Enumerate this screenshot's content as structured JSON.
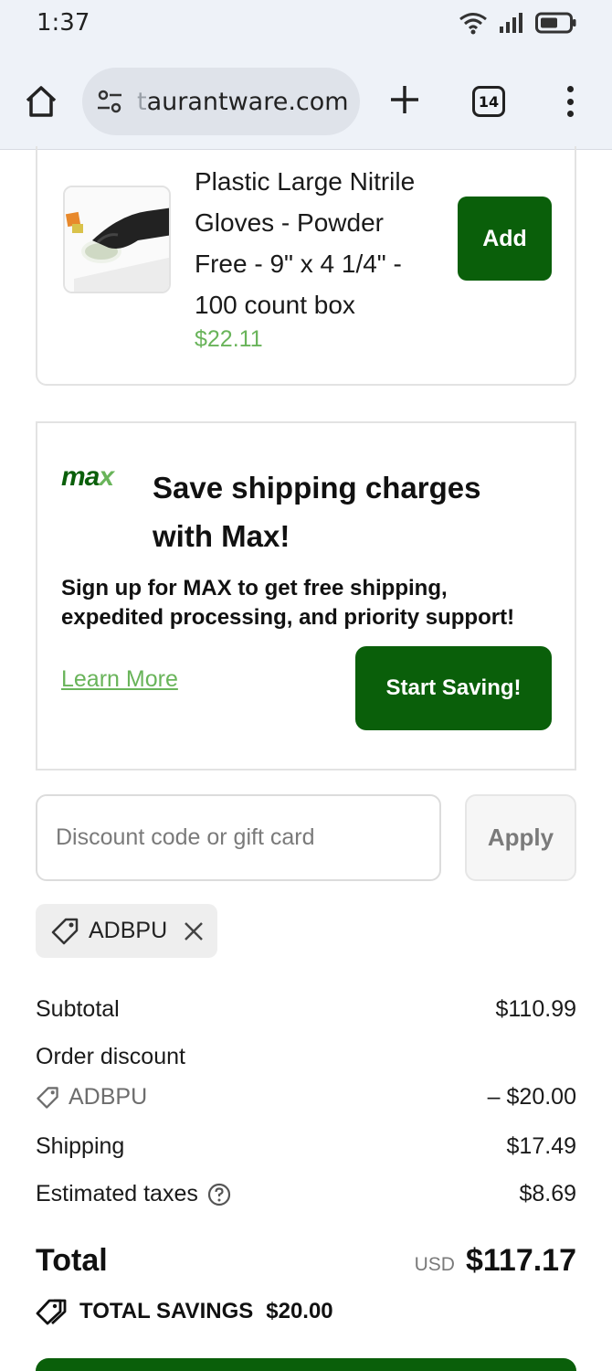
{
  "status_bar": {
    "time": "1:37"
  },
  "browser": {
    "url_dim": "t",
    "url_main": "aurantware.com",
    "tab_count": "14"
  },
  "product": {
    "name": "Plastic Large Nitrile Gloves - Powder Free - 9\" x 4 1/4\" - 100 count box",
    "price": "$22.11",
    "add_label": "Add"
  },
  "max_promo": {
    "logo": "ma",
    "logo_x": "x",
    "title": "Save shipping charges with Max!",
    "description": "Sign up for MAX to get free shipping, expedited processing, and priority support!",
    "learn_more": "Learn More",
    "cta": "Start Saving!"
  },
  "discount": {
    "placeholder": "Discount code or gift card",
    "apply_label": "Apply",
    "applied_code": "ADBPU"
  },
  "summary": {
    "subtotal_label": "Subtotal",
    "subtotal_value": "$110.99",
    "order_discount_label": "Order discount",
    "discount_code": "ADBPU",
    "discount_value": "– $20.00",
    "shipping_label": "Shipping",
    "shipping_value": "$17.49",
    "taxes_label": "Estimated taxes",
    "taxes_value": "$8.69",
    "total_label": "Total",
    "total_currency": "USD",
    "total_value": "$117.17",
    "savings_label": "TOTAL SAVINGS",
    "savings_value": "$20.00"
  },
  "colors": {
    "brand_green": "#0a5f0a",
    "accent_green": "#69b45a"
  },
  "icons": [
    "wifi-icon",
    "signal-icon",
    "battery-icon",
    "home-icon",
    "tune-icon",
    "plus-icon",
    "tabs-icon",
    "more-vert-icon",
    "tag-icon",
    "close-icon",
    "help-icon",
    "savings-tag-icon"
  ]
}
